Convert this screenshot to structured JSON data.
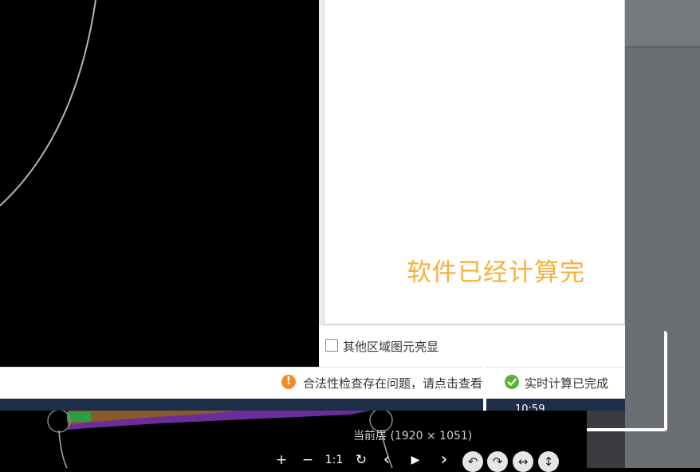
{
  "overlay_text": "软件已经计算完",
  "panel": {
    "highlight_label": "其他区域图元亮显"
  },
  "status": {
    "warning_text": "合法性检查存在问题，请点击查看",
    "calc_text": "实时计算已完成",
    "time": "10:59"
  },
  "viewer": {
    "layer_text": "当前层 (1920 × 1051)",
    "toolbar": {
      "zoom_in": "+",
      "zoom_out": "−",
      "actual_size": "1:1",
      "refresh": "↻",
      "prev": "‹",
      "play": "▶",
      "next": "›",
      "rotate_left": "↶",
      "rotate_right": "↷",
      "fit_width": "↔",
      "fit_height": "↕"
    }
  },
  "colors": {
    "overlay_text": "#f5b13b",
    "warning": "#f28c28",
    "ok": "#5cb531"
  }
}
